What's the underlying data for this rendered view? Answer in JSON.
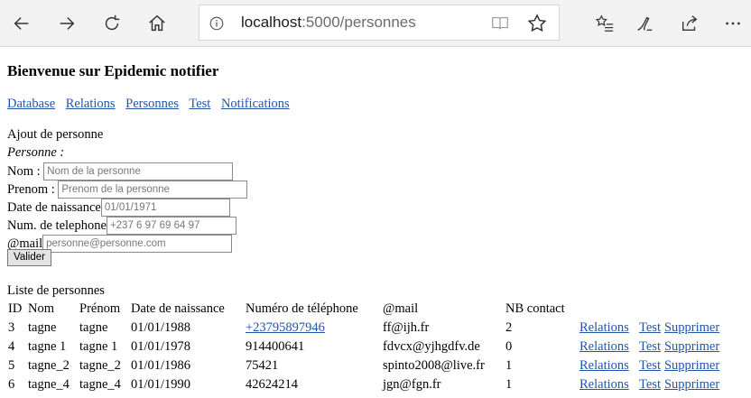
{
  "browser": {
    "url_host": "localhost",
    "url_rest": ":5000/personnes"
  },
  "page": {
    "title": "Bienvenue sur Epidemic notifier",
    "nav": [
      "Database",
      "Relations",
      "Personnes",
      "Test",
      "Notifications"
    ]
  },
  "form": {
    "heading": "Ajout de personne",
    "subheading": "Personne :",
    "fields": [
      {
        "label": "Nom :",
        "placeholder": "Nom de la personne"
      },
      {
        "label": "Prenom :",
        "placeholder": "Prenom de la personne"
      },
      {
        "label": "Date de naissance",
        "placeholder": "01/01/1971"
      },
      {
        "label": "Num. de telephone",
        "placeholder": "+237 6 97 69 64 97"
      },
      {
        "label": "@mail",
        "placeholder": "personne@personne.com"
      }
    ],
    "submit_label": "Valider"
  },
  "list": {
    "title": "Liste de personnes",
    "columns": [
      "ID",
      "Nom",
      "Prénom",
      "Date de naissance",
      "Numéro de téléphone",
      "@mail",
      "NB contact"
    ],
    "rows": [
      {
        "id": "3",
        "nom": "tagne",
        "prenom": "tagne",
        "date": "01/01/1988",
        "tel": "+23795897946",
        "tel_is_link": true,
        "mail": "ff@ijh.fr",
        "nb": "2"
      },
      {
        "id": "4",
        "nom": "tagne 1",
        "prenom": "tagne 1",
        "date": "01/01/1978",
        "tel": "914400641",
        "tel_is_link": false,
        "mail": "fdvcx@yjhgdfv.de",
        "nb": "0"
      },
      {
        "id": "5",
        "nom": "tagne_2",
        "prenom": "tagne_2",
        "date": "01/01/1986",
        "tel": "75421",
        "tel_is_link": false,
        "mail": "spinto2008@live.fr",
        "nb": "1"
      },
      {
        "id": "6",
        "nom": "tagne_4",
        "prenom": "tagne_4",
        "date": "01/01/1990",
        "tel": "42624214",
        "tel_is_link": false,
        "mail": "jgn@fgn.fr",
        "nb": "1"
      }
    ],
    "row_actions": [
      "Relations",
      "Test",
      "Supprimer"
    ]
  }
}
